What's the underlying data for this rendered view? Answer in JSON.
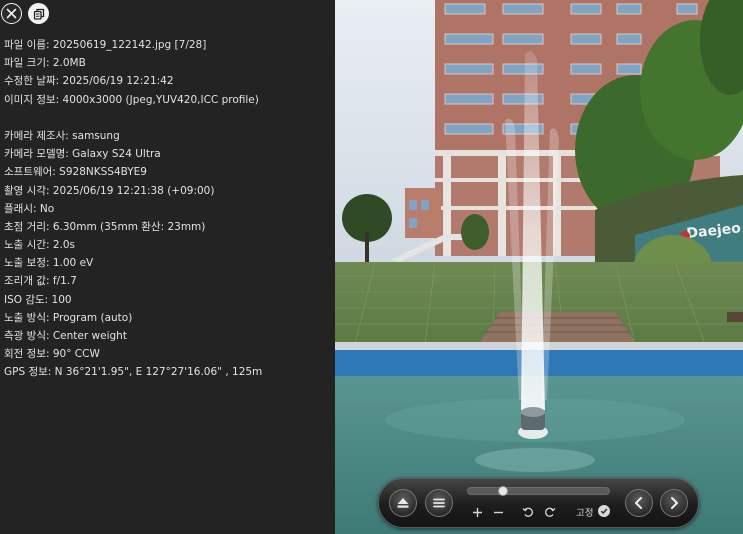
{
  "info": {
    "rows": [
      "파일 이름: 20250619_122142.jpg [7/28]",
      "파일 크기: 2.0MB",
      "수정한 날짜: 2025/06/19 12:21:42",
      "이미지 정보: 4000x3000 (Jpeg,YUV420,ICC profile)",
      "",
      "카메라 제조사: samsung",
      "카메라 모델명: Galaxy S24 Ultra",
      "소프트웨어: S928NKSS4BYE9",
      "촬영 시각: 2025/06/19 12:21:38 (+09:00)",
      "플래시: No",
      "초점 거리: 6.30mm (35mm 환산: 23mm)",
      "노출 시간: 2.0s",
      "노출 보정: 1.00 eV",
      "조리개 값: f/1.7",
      "ISO 감도: 100",
      "노출 방식: Program (auto)",
      "측광 방식: Center weight",
      "회전 정보: 90° CCW",
      "GPS 정보: N 36°21'1.95\", E 127°27'16.06\" , 125m"
    ]
  },
  "photo": {
    "sign_text": "Daejeo"
  },
  "controls": {
    "fix_label": "고정",
    "slider_position": 0.23
  },
  "icons": {
    "close": "close-icon",
    "copy": "copy-icon",
    "eject": "eject-icon",
    "menu": "menu-icon",
    "zoom_in": "plus-icon",
    "zoom_out": "minus-icon",
    "rotate_left": "rotate-left-icon",
    "rotate_right": "rotate-right-icon",
    "check": "check-icon",
    "prev": "chevron-left-icon",
    "next": "chevron-right-icon"
  }
}
